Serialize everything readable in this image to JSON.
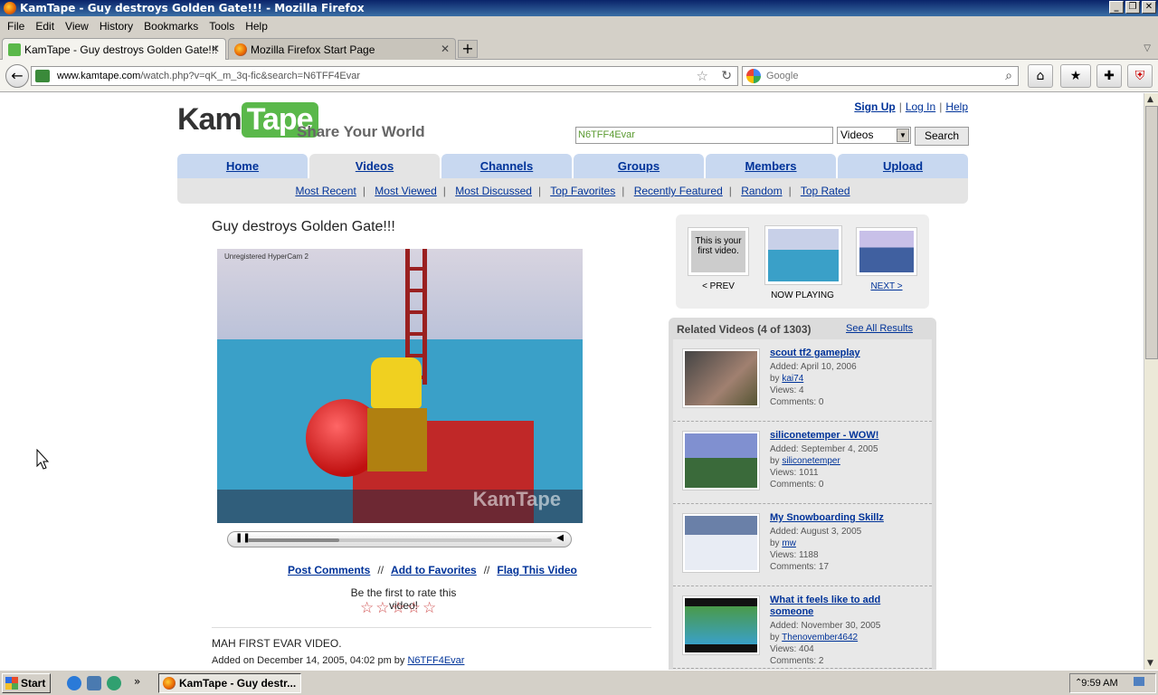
{
  "window": {
    "title": "KamTape - Guy destroys Golden Gate!!! - Mozilla Firefox"
  },
  "menu": [
    "File",
    "Edit",
    "View",
    "History",
    "Bookmarks",
    "Tools",
    "Help"
  ],
  "tabs": [
    {
      "label": "KamTape - Guy destroys Golden Gate!!!",
      "active": true
    },
    {
      "label": "Mozilla Firefox Start Page",
      "active": false
    }
  ],
  "navbar": {
    "url_host": "www.kamtape.com",
    "url_path": "/watch.php?v=qK_m_3q-fic&search=N6TFF4Evar",
    "search_placeholder": "Google"
  },
  "site": {
    "logo_left": "Kam",
    "logo_right": "Tape",
    "tagline": "Share Your World",
    "toplinks": [
      "Sign Up",
      "Log In",
      "Help"
    ],
    "search_value": "N6TFF4Evar",
    "search_category": "Videos",
    "search_button": "Search",
    "nav": [
      "Home",
      "Videos",
      "Channels",
      "Groups",
      "Members",
      "Upload"
    ],
    "subnav": [
      "Most Recent",
      "Most Viewed",
      "Most Discussed",
      "Top Favorites",
      "Recently Featured",
      "Random",
      "Top Rated"
    ]
  },
  "video": {
    "title": "Guy destroys Golden Gate!!!",
    "hypercam": "Unregistered HyperCam 2",
    "watermark": "KamTape",
    "progress": 0.3,
    "actions": [
      "Post Comments",
      "Add to Favorites",
      "Flag This Video"
    ],
    "rate_text": "Be the first to rate this video!",
    "stars": "☆☆☆☆☆",
    "description": "MAH FIRST EVAR VIDEO.",
    "added_prefix": "Added on December 14, 2005, 04:02 pm by",
    "added_user": "N6TFF4Evar"
  },
  "prevnext": {
    "prev_thumb_text": "This is your first video.",
    "prev": "< PREV",
    "now": "NOW PLAYING",
    "next": "NEXT >"
  },
  "related": {
    "header": "Related Videos (4 of 1303)",
    "see_all": "See All Results",
    "items": [
      {
        "title": "scout tf2 gameplay",
        "added": "Added: April 10, 2006",
        "by": "by",
        "user": "kai74",
        "views": "Views: 4",
        "comments": "Comments: 0"
      },
      {
        "title": "siliconetemper - WOW!",
        "added": "Added: September 4, 2005",
        "by": "by",
        "user": "siliconetemper",
        "views": "Views: 1011",
        "comments": "Comments: 0"
      },
      {
        "title": "My Snowboarding Skillz",
        "added": "Added: August 3, 2005",
        "by": "by",
        "user": "mw",
        "views": "Views: 1188",
        "comments": "Comments: 17"
      },
      {
        "title": "What it feels like to add someone",
        "added": "Added: November 30, 2005",
        "by": "by",
        "user": "Thenovember4642",
        "views": "Views: 404",
        "comments": "Comments: 2"
      }
    ]
  },
  "taskbar": {
    "start": "Start",
    "task": "KamTape - Guy destr...",
    "clock": "9:59 AM"
  }
}
